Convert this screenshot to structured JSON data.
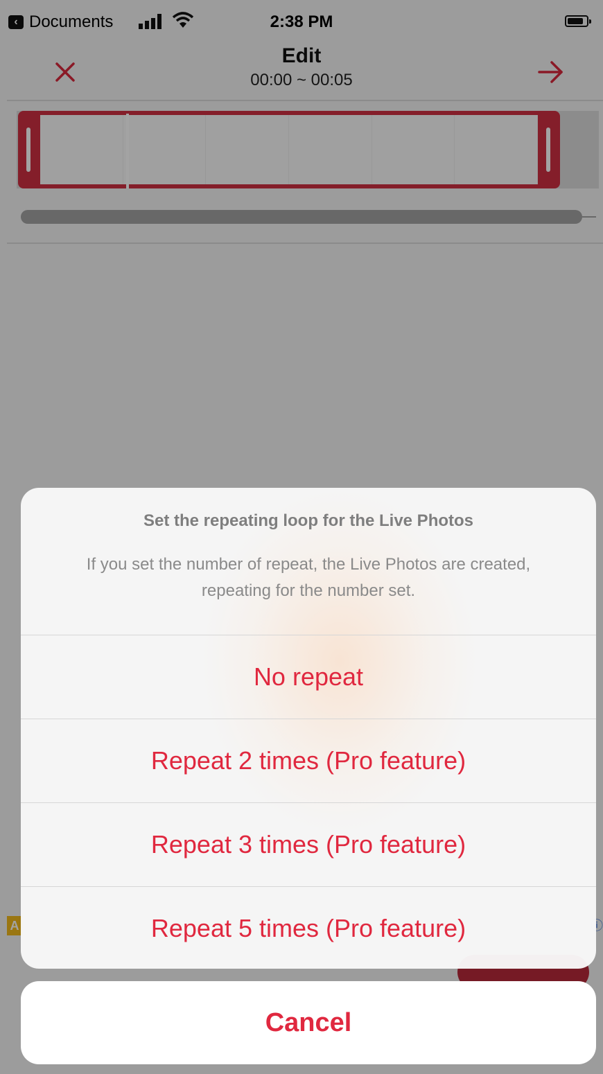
{
  "status_bar": {
    "back_app": "Documents",
    "time": "2:38 PM"
  },
  "nav": {
    "title": "Edit",
    "subtitle": "00:00 ~ 00:05"
  },
  "ad": {
    "badge": "A"
  },
  "sheet": {
    "title": "Set the repeating loop for the Live Photos",
    "message": "If you set the number of repeat, the Live Photos are created, repeating for the number set.",
    "options": [
      {
        "label": "No repeat"
      },
      {
        "label": "Repeat 2 times (Pro feature)"
      },
      {
        "label": "Repeat 3 times (Pro feature)"
      },
      {
        "label": "Repeat 5 times (Pro feature)"
      }
    ],
    "cancel": "Cancel"
  },
  "colors": {
    "accent": "#e0283f",
    "trim_frame": "#cf2f43",
    "ad_badge": "#f1b91d"
  }
}
